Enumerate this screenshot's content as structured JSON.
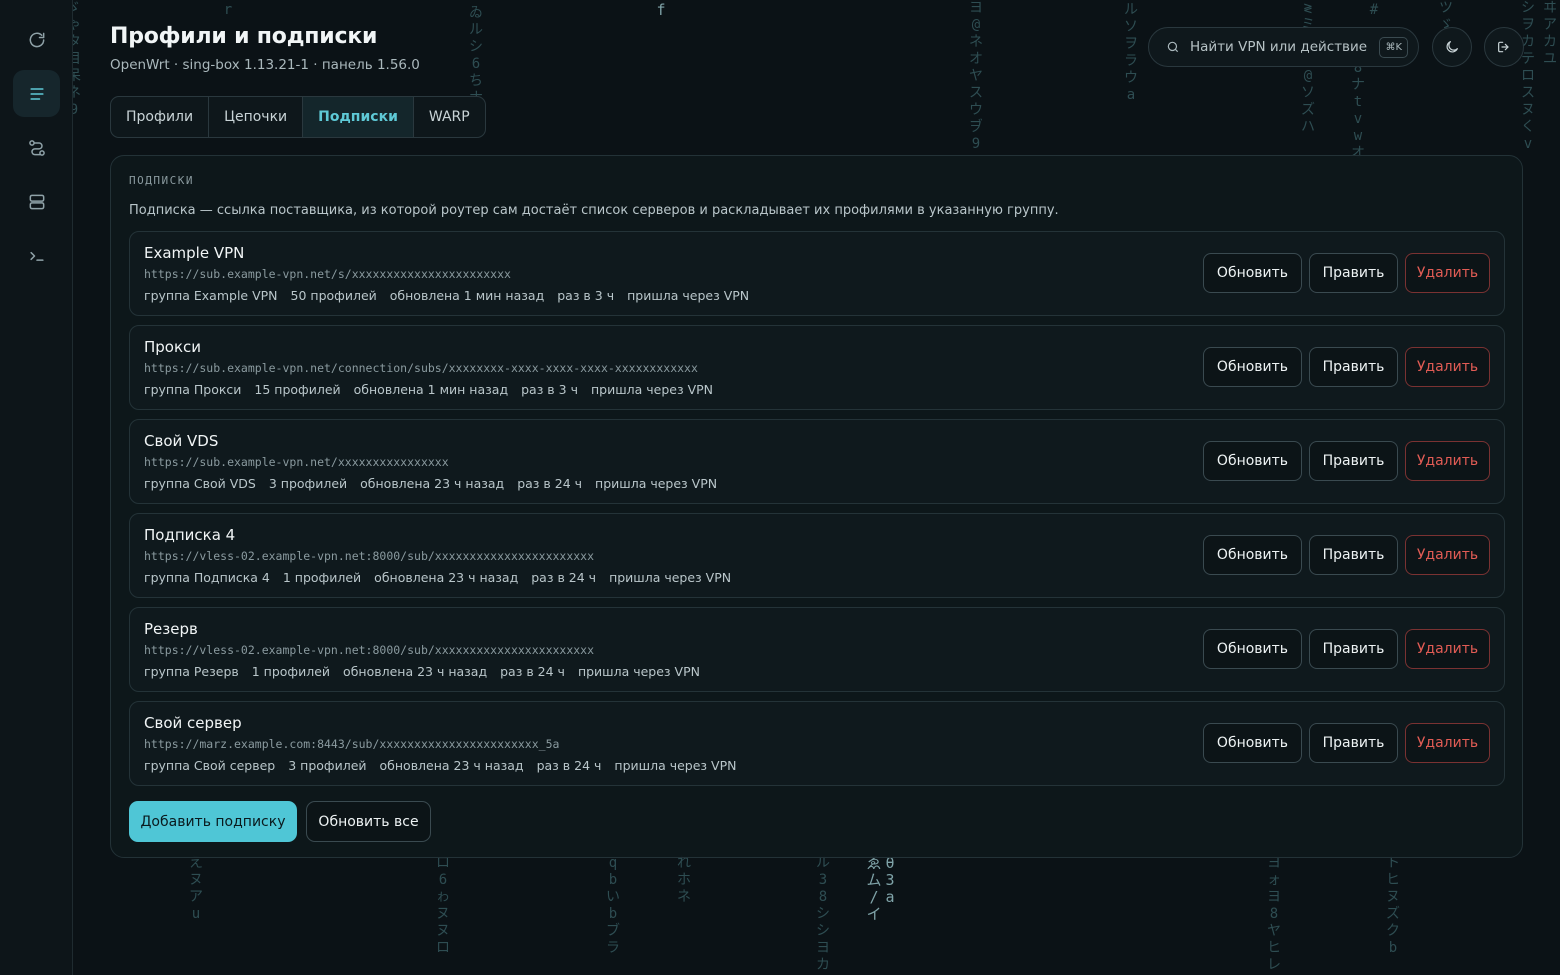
{
  "header": {
    "title": "Профили и подписки",
    "subtitle": "OpenWrt · sing-box 1.13.21-1 · панель 1.56.0"
  },
  "tabs": [
    {
      "label": "Профили",
      "active": false
    },
    {
      "label": "Цепочки",
      "active": false
    },
    {
      "label": "Подписки",
      "active": true
    },
    {
      "label": "WARP",
      "active": false
    }
  ],
  "search": {
    "placeholder": "Найти VPN или действие",
    "shortcut": "⌘K"
  },
  "sidebar": {
    "items": [
      {
        "icon": "refresh-icon",
        "active": false
      },
      {
        "icon": "list-icon",
        "active": true
      },
      {
        "icon": "route-icon",
        "active": false
      },
      {
        "icon": "server-icon",
        "active": false
      },
      {
        "icon": "terminal-icon",
        "active": false
      }
    ]
  },
  "section": {
    "label": "ПОДПИСКИ",
    "description": "Подписка — ссылка поставщика, из которой роутер сам достаёт список серверов и раскладывает их профилями в указанную группу."
  },
  "subscriptions": [
    {
      "name": "Example VPN",
      "url": "https://sub.example-vpn.net/s/xxxxxxxxxxxxxxxxxxxxxxx",
      "group": "группа Example VPN",
      "profiles": "50 профилей",
      "updated": "обновлена 1 мин назад",
      "interval": "раз в 3 ч",
      "via": "пришла через VPN"
    },
    {
      "name": "Прокси",
      "url": "https://sub.example-vpn.net/connection/subs/xxxxxxxx-xxxx-xxxx-xxxx-xxxxxxxxxxxx",
      "group": "группа Прокси",
      "profiles": "15 профилей",
      "updated": "обновлена 1 мин назад",
      "interval": "раз в 3 ч",
      "via": "пришла через VPN"
    },
    {
      "name": "Свой VDS",
      "url": "https://sub.example-vpn.net/xxxxxxxxxxxxxxxx",
      "group": "группа Свой VDS",
      "profiles": "3 профилей",
      "updated": "обновлена 23 ч назад",
      "interval": "раз в 24 ч",
      "via": "пришла через VPN"
    },
    {
      "name": "Подписка 4",
      "url": "https://vless-02.example-vpn.net:8000/sub/xxxxxxxxxxxxxxxxxxxxxxx",
      "group": "группа Подписка 4",
      "profiles": "1 профилей",
      "updated": "обновлена 23 ч назад",
      "interval": "раз в 24 ч",
      "via": "пришла через VPN"
    },
    {
      "name": "Резерв",
      "url": "https://vless-02.example-vpn.net:8000/sub/xxxxxxxxxxxxxxxxxxxxxxx",
      "group": "группа Резерв",
      "profiles": "1 профилей",
      "updated": "обновлена 23 ч назад",
      "interval": "раз в 24 ч",
      "via": "пришла через VPN"
    },
    {
      "name": "Свой сервер",
      "url": "https://marz.example.com:8443/sub/xxxxxxxxxxxxxxxxxxxxxxx_5a",
      "group": "группа Свой сервер",
      "profiles": "3 профилей",
      "updated": "обновлена 23 ч назад",
      "interval": "раз в 24 ч",
      "via": "пришла через VPN"
    }
  ],
  "actions": {
    "refresh": "Обновить",
    "edit": "Править",
    "delete": "Удалить",
    "add_subscription": "Добавить подписку",
    "refresh_all": "Обновить все"
  },
  "colors": {
    "background": "#0b1216",
    "accent": "#4fc6d6",
    "danger": "#e25c55",
    "panel": "#0e171b"
  }
}
